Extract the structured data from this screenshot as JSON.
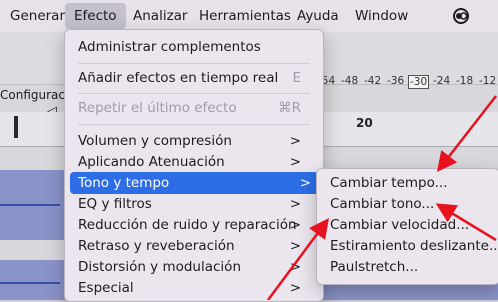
{
  "menubar": {
    "items": [
      "Generar",
      "Efecto",
      "Analizar",
      "Herramientas",
      "Ayuda",
      "Window"
    ]
  },
  "app": {
    "config_label": "Configurac",
    "meter_ticks": [
      "-54",
      "-48",
      "-42",
      "-36",
      "-30",
      "-24",
      "-18",
      "-12"
    ],
    "ruler_number": "20"
  },
  "effect_menu": {
    "items": [
      {
        "label": "Administrar complementos",
        "shortcut": ""
      },
      {
        "label": "Añadir efectos en tiempo real",
        "shortcut": "E"
      },
      {
        "label": "Repetir el último efecto",
        "shortcut": "⌘R"
      },
      {
        "label": "Volumen y compresión",
        "shortcut": ">"
      },
      {
        "label": "Aplicando Atenuación",
        "shortcut": ">"
      },
      {
        "label": "Tono y tempo",
        "shortcut": ">"
      },
      {
        "label": "EQ y filtros",
        "shortcut": ">"
      },
      {
        "label": "Reducción de ruido y reparación",
        "shortcut": ">"
      },
      {
        "label": "Retraso y reveberación",
        "shortcut": ">"
      },
      {
        "label": "Distorsión y modulación",
        "shortcut": ">"
      },
      {
        "label": "Especial",
        "shortcut": ">"
      }
    ]
  },
  "submenu": {
    "items": [
      "Cambiar tempo...",
      "Cambiar tono...",
      "Cambiar velocidad...",
      "Estiramiento deslizante...",
      "Paulstretch..."
    ]
  },
  "colors": {
    "highlight": "#2d6ee6",
    "annotation_arrow": "#e8121e",
    "menu_background": "#ebe6ee",
    "track": "#8a93c9"
  }
}
